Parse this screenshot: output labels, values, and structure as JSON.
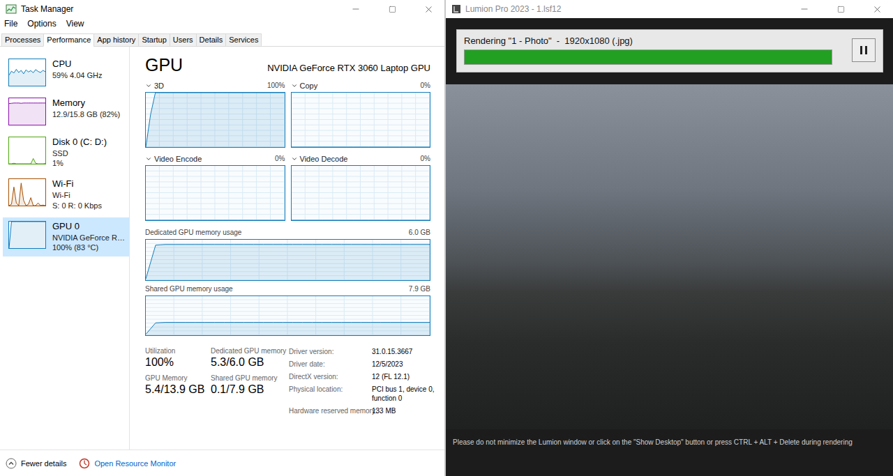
{
  "task_manager": {
    "window": {
      "title": "Task Manager"
    },
    "menu": [
      "File",
      "Options",
      "View"
    ],
    "tabs": [
      {
        "label": "Processes",
        "selected": false
      },
      {
        "label": "Performance",
        "selected": true
      },
      {
        "label": "App history",
        "selected": false
      },
      {
        "label": "Startup",
        "selected": false
      },
      {
        "label": "Users",
        "selected": false
      },
      {
        "label": "Details",
        "selected": false
      },
      {
        "label": "Services",
        "selected": false
      }
    ],
    "sidebar": {
      "items": [
        {
          "name": "CPU",
          "lines": [
            "59% 4.04 GHz"
          ],
          "selected": false,
          "color": "#117dbb",
          "values": [
            40,
            55,
            48,
            62,
            50,
            58,
            45,
            60,
            52,
            57,
            49,
            61,
            54,
            50,
            58,
            53
          ]
        },
        {
          "name": "Memory",
          "lines": [
            "12.9/15.8 GB (82%)"
          ],
          "selected": false,
          "color": "#8b12ae",
          "values": [
            80,
            81,
            82,
            82,
            82,
            81,
            82,
            82,
            82,
            82,
            82,
            82,
            82,
            82,
            82,
            82
          ]
        },
        {
          "name": "Disk 0 (C: D:)",
          "lines": [
            "SSD",
            "1%"
          ],
          "selected": false,
          "color": "#4da60c",
          "values": [
            0,
            0,
            2,
            0,
            0,
            0,
            0,
            0,
            0,
            0,
            20,
            2,
            0,
            0,
            0,
            1
          ]
        },
        {
          "name": "Wi-Fi",
          "lines": [
            "Wi-Fi",
            "S: 0 R: 0 Kbps"
          ],
          "selected": false,
          "color": "#a74f01",
          "values": [
            0,
            5,
            70,
            10,
            0,
            85,
            20,
            0,
            5,
            30,
            0,
            0,
            10,
            0,
            2,
            0
          ]
        },
        {
          "name": "GPU 0",
          "lines": [
            "NVIDIA GeForce R…",
            "100% (83 °C)"
          ],
          "selected": true,
          "color": "#117dbb",
          "values": [
            0,
            100,
            100,
            100,
            100,
            100,
            100,
            100,
            100,
            100,
            100,
            100,
            100,
            100,
            100,
            100
          ]
        }
      ]
    },
    "panel": {
      "title": "GPU",
      "device": "NVIDIA GeForce RTX 3060 Laptop GPU",
      "engines": [
        {
          "label": "3D",
          "reading": "100%",
          "max": 100,
          "values": [
            0,
            60,
            100,
            100,
            100,
            100,
            100,
            100,
            100,
            100,
            100,
            100,
            100,
            100,
            100,
            100,
            100,
            100,
            100,
            100,
            100,
            100,
            100,
            100,
            100,
            100,
            100,
            100,
            100,
            100
          ]
        },
        {
          "label": "Copy",
          "reading": "0%",
          "max": 100,
          "values": [
            0,
            0,
            0,
            0,
            0,
            0,
            0,
            0,
            0,
            0
          ]
        },
        {
          "label": "Video Encode",
          "reading": "0%",
          "max": 100,
          "values": [
            0,
            0,
            0,
            0,
            0,
            0,
            0,
            0,
            0,
            0
          ]
        },
        {
          "label": "Video Decode",
          "reading": "0%",
          "max": 100,
          "values": [
            0,
            0,
            0,
            0,
            0,
            0,
            0,
            0,
            0,
            0
          ]
        }
      ],
      "memory_charts": [
        {
          "label": "Dedicated GPU memory usage",
          "reading": "6.0 GB",
          "max": 6.0,
          "values": [
            0.2,
            5.2,
            5.3,
            5.3,
            5.3,
            5.3,
            5.3,
            5.3,
            5.3,
            5.3,
            5.3,
            5.3,
            5.3,
            5.3,
            5.3,
            5.3,
            5.3,
            5.3,
            5.3,
            5.3,
            5.3,
            5.3,
            5.3,
            5.3,
            5.3,
            5.3,
            5.3,
            5.3,
            5.3,
            5.3
          ]
        },
        {
          "label": "Shared GPU memory usage",
          "reading": "7.9 GB",
          "max": 7.9,
          "values": [
            0.2,
            2.5,
            2.6,
            2.6,
            2.6,
            2.6,
            2.6,
            2.6,
            2.6,
            2.6,
            2.6,
            2.6,
            2.6,
            2.6,
            2.6,
            2.6,
            2.6,
            2.6,
            2.6,
            2.6,
            2.6,
            2.6,
            2.6,
            2.6,
            2.6,
            2.6,
            2.6,
            2.6,
            2.6,
            2.6
          ]
        }
      ],
      "stats": [
        {
          "label": "Utilization",
          "value": "100%"
        },
        {
          "label": "Dedicated GPU memory",
          "value": "5.3/6.0 GB"
        },
        {
          "label": "GPU Memory",
          "value": "5.4/13.9 GB"
        },
        {
          "label": "Shared GPU memory",
          "value": "0.1/7.9 GB"
        }
      ],
      "details": [
        {
          "label": "Driver version:",
          "value": "31.0.15.3667"
        },
        {
          "label": "Driver date:",
          "value": "12/5/2023"
        },
        {
          "label": "DirectX version:",
          "value": "12 (FL 12.1)"
        },
        {
          "label": "Physical location:",
          "value": "PCI bus 1, device 0, function 0"
        },
        {
          "label": "Hardware reserved memory:",
          "value": "133 MB"
        }
      ]
    },
    "footer": {
      "fewer_details": "Fewer details",
      "resource_monitor": "Open Resource Monitor"
    }
  },
  "lumion": {
    "window": {
      "title": "Lumion Pro 2023 - 1.lsf12"
    },
    "render": {
      "status": "Rendering \"1 - Photo\"  -  1920x1080 (.jpg)",
      "level": 1.0
    },
    "notice": "Please do not minimize the Lumion window or click on the \"Show Desktop\" button or press CTRL + ALT + Delete during rendering"
  }
}
